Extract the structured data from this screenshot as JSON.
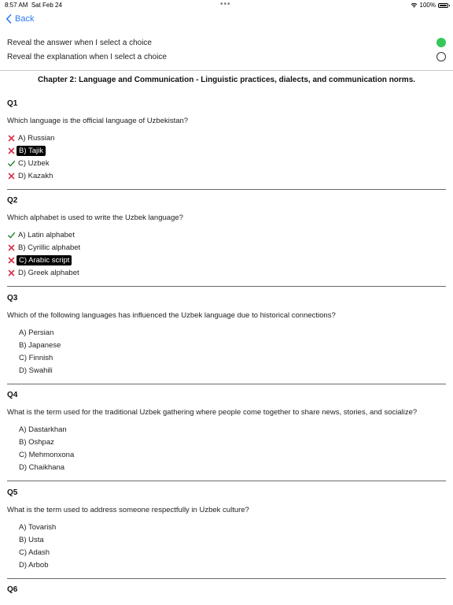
{
  "status": {
    "time": "8:57 AM",
    "date": "Sat Feb 24",
    "battery": "100%",
    "dots": "•••"
  },
  "nav": {
    "back_label": "Back"
  },
  "settings": {
    "reveal_answer": {
      "label": "Reveal the answer when I select a choice",
      "on": true
    },
    "reveal_explanation": {
      "label": "Reveal the explanation when I select a choice",
      "on": false
    }
  },
  "chapter": {
    "title": "Chapter 2: Language and Communication - Linguistic practices, dialects, and communication norms."
  },
  "questions": [
    {
      "num": "Q1",
      "text": "Which language is the official language of Uzbekistan?",
      "options": [
        {
          "label": "A) Russian",
          "mark": "wrong",
          "selected": false
        },
        {
          "label": "B) Tajik",
          "mark": "wrong",
          "selected": true
        },
        {
          "label": "C) Uzbek",
          "mark": "correct",
          "selected": false
        },
        {
          "label": "D) Kazakh",
          "mark": "wrong",
          "selected": false
        }
      ]
    },
    {
      "num": "Q2",
      "text": "Which alphabet is used to write the Uzbek language?",
      "options": [
        {
          "label": "A) Latin alphabet",
          "mark": "correct",
          "selected": false
        },
        {
          "label": "B) Cyrillic alphabet",
          "mark": "wrong",
          "selected": false
        },
        {
          "label": "C) Arabic script",
          "mark": "wrong",
          "selected": true
        },
        {
          "label": "D) Greek alphabet",
          "mark": "wrong",
          "selected": false
        }
      ]
    },
    {
      "num": "Q3",
      "text": "Which of the following languages has influenced the Uzbek language due to historical connections?",
      "options": [
        {
          "label": "A) Persian",
          "mark": "none",
          "selected": false
        },
        {
          "label": "B) Japanese",
          "mark": "none",
          "selected": false
        },
        {
          "label": "C) Finnish",
          "mark": "none",
          "selected": false
        },
        {
          "label": "D) Swahili",
          "mark": "none",
          "selected": false
        }
      ]
    },
    {
      "num": "Q4",
      "text": "What is the term used for the traditional Uzbek gathering where people come together to share news, stories, and socialize?",
      "options": [
        {
          "label": "A) Dastarkhan",
          "mark": "none",
          "selected": false
        },
        {
          "label": "B) Oshpaz",
          "mark": "none",
          "selected": false
        },
        {
          "label": "C) Mehmonxona",
          "mark": "none",
          "selected": false
        },
        {
          "label": "D) Chaikhana",
          "mark": "none",
          "selected": false
        }
      ]
    },
    {
      "num": "Q5",
      "text": "What is the term used to address someone respectfully in Uzbek culture?",
      "options": [
        {
          "label": "A) Tovarish",
          "mark": "none",
          "selected": false
        },
        {
          "label": "B) Usta",
          "mark": "none",
          "selected": false
        },
        {
          "label": "C) Adash",
          "mark": "none",
          "selected": false
        },
        {
          "label": "D) Arbob",
          "mark": "none",
          "selected": false
        }
      ]
    },
    {
      "num": "Q6",
      "text": "",
      "options": []
    }
  ],
  "colors": {
    "accent": "#2b79f1",
    "toggle_on": "#34c759",
    "wrong": "#d9314b",
    "correct": "#2e8b3a",
    "selected_bg": "#000000"
  },
  "icons": {
    "wrong": "x-mark-icon",
    "correct": "checkmark-icon",
    "back": "chevron-left-icon",
    "wifi": "wifi-icon",
    "battery": "battery-icon"
  }
}
